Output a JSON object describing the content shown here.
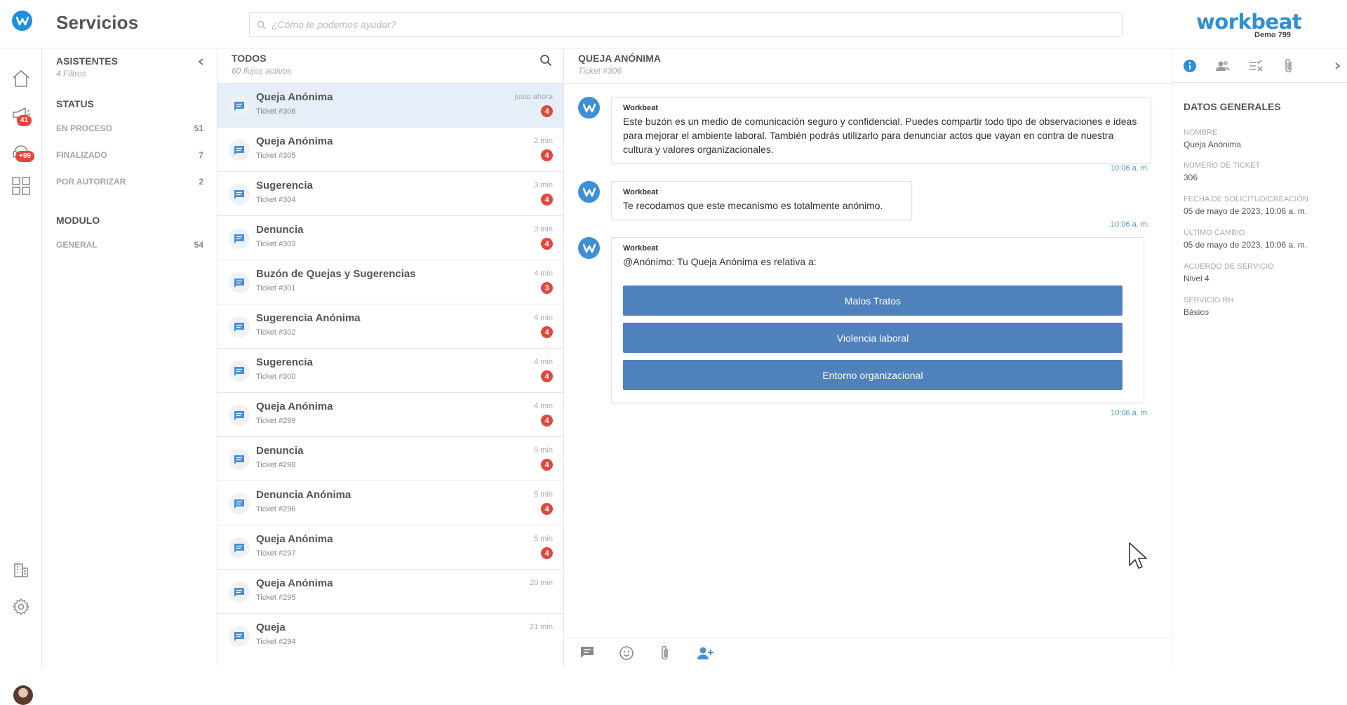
{
  "header": {
    "app_title": "Servicios",
    "search_placeholder": "¿Cómo te podemos ayudar?",
    "brand_name": "workbeat",
    "brand_sub": "Demo 799"
  },
  "rail": {
    "items": [
      {
        "icon": "home-icon"
      },
      {
        "icon": "megaphone-icon",
        "badge": "41"
      },
      {
        "icon": "support-headset-icon",
        "badge": "+99"
      },
      {
        "icon": "apps-grid-icon"
      }
    ],
    "bottom": [
      {
        "icon": "building-icon"
      },
      {
        "icon": "gear-icon"
      }
    ]
  },
  "filters": {
    "title": "ASISTENTES",
    "subtitle": "4 Filtros",
    "groups": [
      {
        "title": "STATUS",
        "items": [
          {
            "label": "EN PROCESO",
            "count": "51"
          },
          {
            "label": "FINALIZADO",
            "count": "7"
          },
          {
            "label": "POR AUTORIZAR",
            "count": "2"
          }
        ]
      },
      {
        "title": "MODULO",
        "items": [
          {
            "label": "GENERAL",
            "count": "54"
          }
        ]
      }
    ]
  },
  "list": {
    "title": "TODOS",
    "subtitle": "60 flujos activos",
    "tickets": [
      {
        "title": "Queja Anónima",
        "sub": "Ticket #306",
        "time": "justo ahora",
        "badge": "4",
        "active": true
      },
      {
        "title": "Queja Anónima",
        "sub": "Ticket #305",
        "time": "2 min",
        "badge": "4"
      },
      {
        "title": "Sugerencia",
        "sub": "Ticket #304",
        "time": "3 min",
        "badge": "4"
      },
      {
        "title": "Denuncia",
        "sub": "Ticket #303",
        "time": "3 min",
        "badge": "4"
      },
      {
        "title": "Buzón de Quejas y Sugerencias",
        "sub": "Ticket #301",
        "time": "4 min",
        "badge": "3"
      },
      {
        "title": "Sugerencia Anónima",
        "sub": "Ticket #302",
        "time": "4 min",
        "badge": "4"
      },
      {
        "title": "Sugerencia",
        "sub": "Ticket #300",
        "time": "4 min",
        "badge": "4"
      },
      {
        "title": "Queja Anónima",
        "sub": "Ticket #299",
        "time": "4 min",
        "badge": "4"
      },
      {
        "title": "Denuncia",
        "sub": "Ticket #298",
        "time": "5 min",
        "badge": "4"
      },
      {
        "title": "Denuncia Anónima",
        "sub": "Ticket #296",
        "time": "5 min",
        "badge": "4"
      },
      {
        "title": "Queja Anónima",
        "sub": "Ticket #297",
        "time": "5 min",
        "badge": "4"
      },
      {
        "title": "Queja Anónima",
        "sub": "Ticket #295",
        "time": "20 min",
        "badge": ""
      },
      {
        "title": "Queja",
        "sub": "Ticket #294",
        "time": "21 min",
        "badge": ""
      }
    ]
  },
  "chat": {
    "title": "QUEJA ANÓNIMA",
    "subtitle": "Ticket #306",
    "messages": [
      {
        "sender": "Workbeat",
        "text": "Este buzón es un medio de comunicación seguro y confidencial. Puedes compartir todo tipo de observaciones e ideas para mejorar el ambiente laboral. También podrás utilizarlo para denunciar actos que vayan en contra de nuestra cultura y valores organizacionales.",
        "time": "10:06 a. m."
      },
      {
        "sender": "Workbeat",
        "text": "Te recodamos que este mecanismo es totalmente anónimo.",
        "time": "10:06 a. m."
      },
      {
        "sender": "Workbeat",
        "text": "@Anónimo:  Tu Queja Anónima es relativa a:",
        "time": "10:06 a. m.",
        "options": [
          "Malos Tratos",
          "Violencia laboral",
          "Entorno organizacional"
        ]
      }
    ]
  },
  "details": {
    "title": "DATOS GENERALES",
    "fields": [
      {
        "label": "NOMBRE",
        "value": "Queja Anónima"
      },
      {
        "label": "NÚMERO DE TICKET",
        "value": "306"
      },
      {
        "label": "FECHA DE SOLICITUD/CREACIÓN",
        "value": "05 de mayo de 2023, 10:06 a. m."
      },
      {
        "label": "ÚLTIMO CAMBIO",
        "value": "05 de mayo de 2023, 10:06 a. m."
      },
      {
        "label": "ACUERDO DE SERVICIO",
        "value": "Nivel 4"
      },
      {
        "label": "SERVICIO RH",
        "value": "Básico"
      }
    ]
  },
  "colors": {
    "accent": "#2d8fd5",
    "badge": "#e2473d",
    "option_button": "#4f81bd",
    "active_row": "#e6eef8"
  }
}
